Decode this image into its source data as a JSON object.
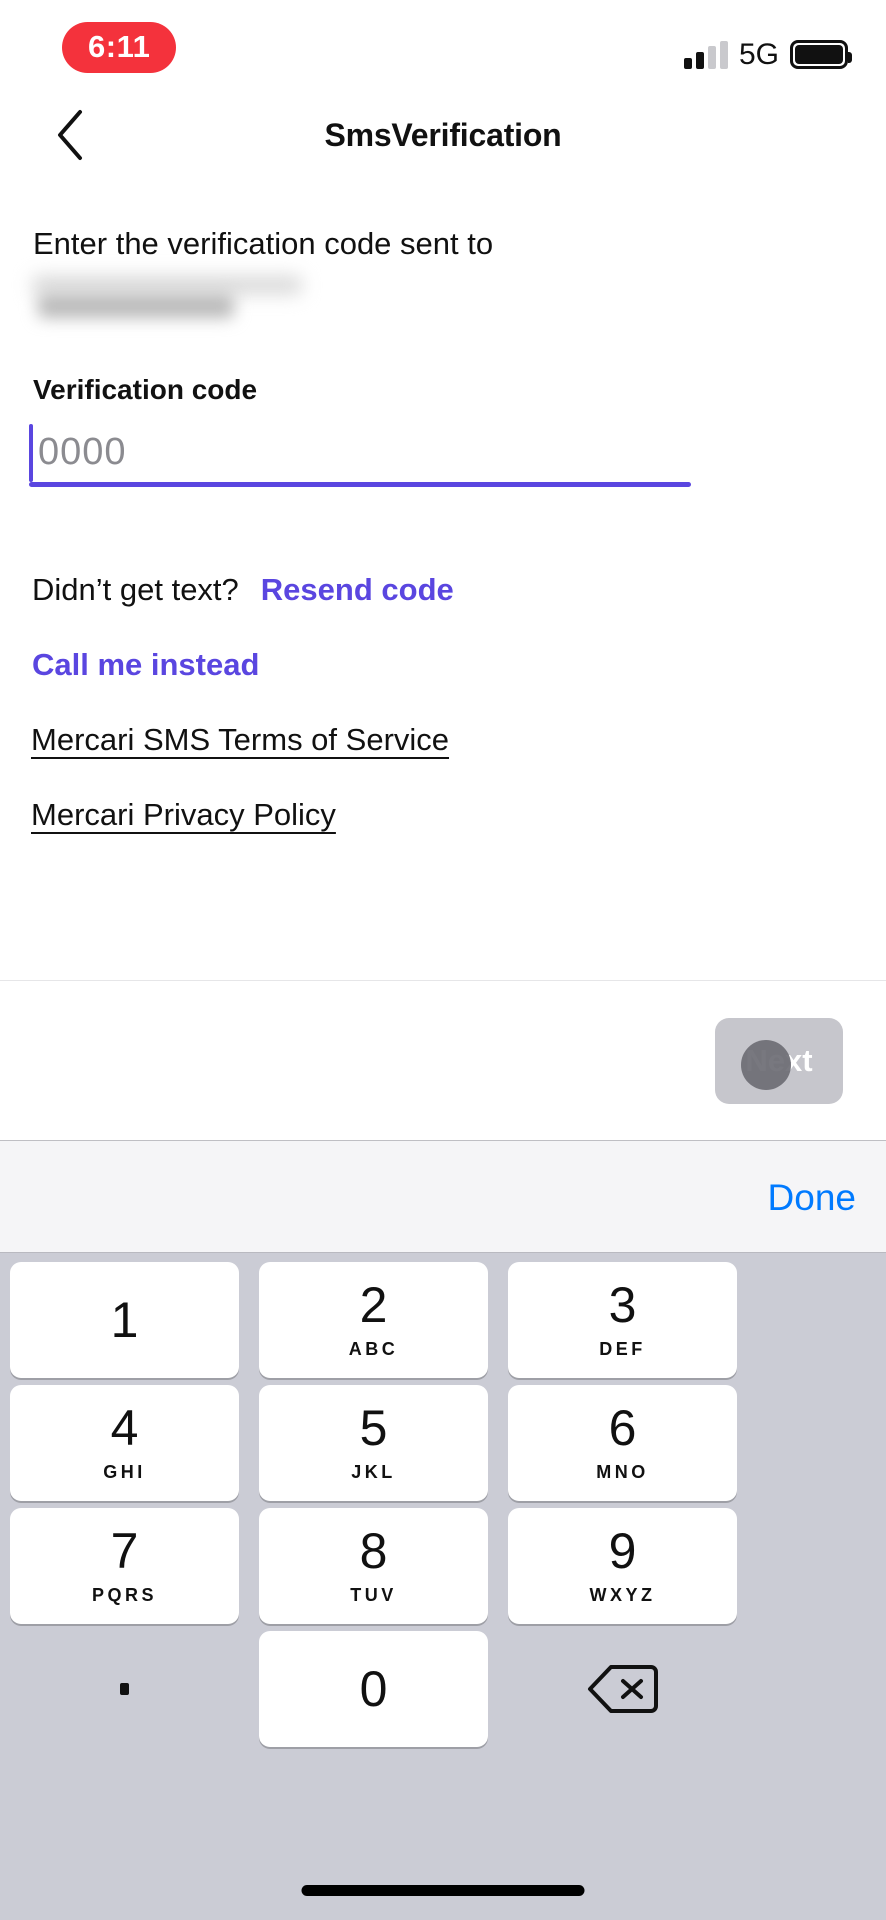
{
  "status_bar": {
    "time": "6:11",
    "time_pill_color": "#F4323C",
    "network": "5G",
    "signal_bars_filled": 2,
    "signal_bars_total": 4,
    "battery_level_percent": 100
  },
  "nav": {
    "title": "SmsVerification",
    "back_icon": "chevron-left-icon"
  },
  "content": {
    "lead_text": "Enter the verification code sent to",
    "phone_number_redacted": "",
    "field_label": "Verification code",
    "code_value": "",
    "code_placeholder": "0000",
    "accent_color": "#5A46E0",
    "resend_question": "Didn’t get text?",
    "resend_link": "Resend code",
    "call_link": "Call me instead",
    "terms_link": "Mercari SMS Terms of Service",
    "privacy_link": "Mercari Privacy Policy"
  },
  "footer": {
    "next_label": "Next",
    "next_disabled_color": "#C6C6CC"
  },
  "keyboard": {
    "done_label": "Done",
    "done_color": "#007AFF",
    "background_color": "#CBCCD5",
    "rows": [
      [
        {
          "digit": "1",
          "letters": ""
        },
        {
          "digit": "2",
          "letters": "ABC"
        },
        {
          "digit": "3",
          "letters": "DEF"
        }
      ],
      [
        {
          "digit": "4",
          "letters": "GHI"
        },
        {
          "digit": "5",
          "letters": "JKL"
        },
        {
          "digit": "6",
          "letters": "MNO"
        }
      ],
      [
        {
          "digit": "7",
          "letters": "PQRS"
        },
        {
          "digit": "8",
          "letters": "TUV"
        },
        {
          "digit": "9",
          "letters": "WXYZ"
        }
      ],
      [
        {
          "digit": ".",
          "letters": "",
          "icon": "period-icon"
        },
        {
          "digit": "0",
          "letters": ""
        },
        {
          "digit": "",
          "letters": "",
          "icon": "backspace-icon"
        }
      ]
    ]
  }
}
